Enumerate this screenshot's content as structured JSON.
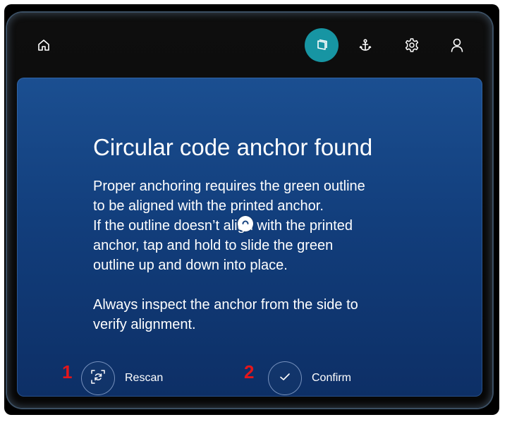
{
  "topbar": {
    "icons": {
      "home": "home-icon",
      "scan": "scan-icon",
      "anchor": "anchor-icon",
      "settings": "gear-icon",
      "user": "user-icon"
    },
    "active_color": "#1795a3"
  },
  "dialog": {
    "title": "Circular code anchor found",
    "lines": [
      "Proper anchoring requires the green outline",
      "to be aligned with the printed anchor.",
      "If the outline doesn’t align with the printed",
      "anchor, tap and hold to slide the green",
      "outline up and down into place.",
      "Always inspect the anchor from the side to",
      "verify alignment."
    ],
    "background_color": "#164585"
  },
  "actions": {
    "rescan": {
      "label": "Rescan",
      "icon": "rescan-icon"
    },
    "confirm": {
      "label": "Confirm",
      "icon": "checkmark-icon"
    }
  },
  "annotations": {
    "marker_1": "1",
    "marker_2": "2",
    "color": "#e3161b"
  }
}
